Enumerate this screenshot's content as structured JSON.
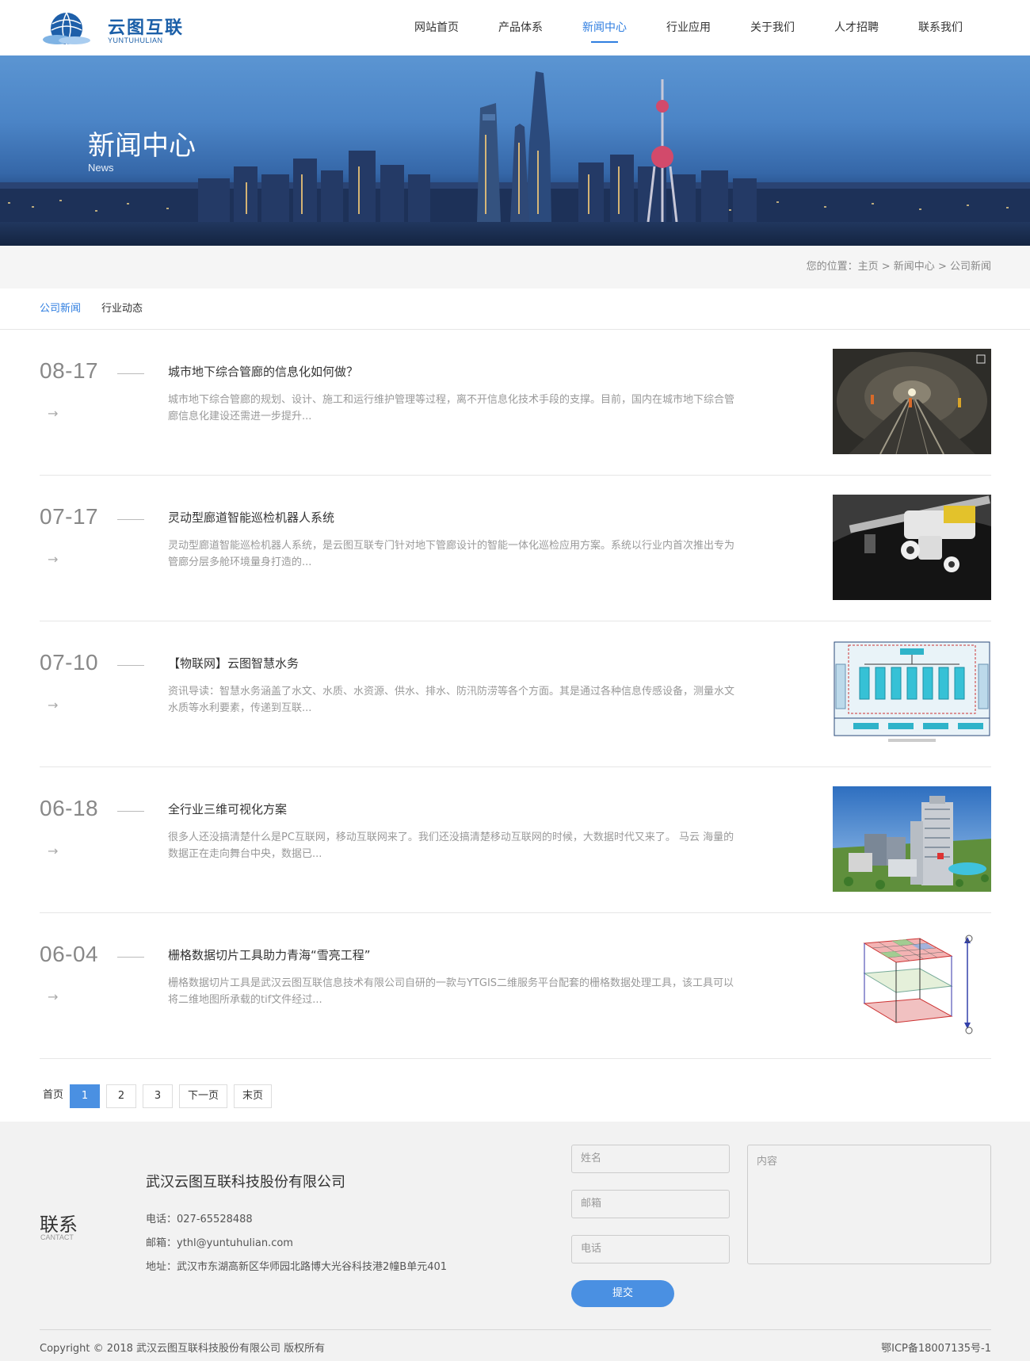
{
  "header": {
    "logo_cn": "云图互联",
    "logo_en": "YUNTUHULIAN",
    "nav": [
      {
        "label": "网站首页"
      },
      {
        "label": "产品体系"
      },
      {
        "label": "新闻中心"
      },
      {
        "label": "行业应用"
      },
      {
        "label": "关于我们"
      },
      {
        "label": "人才招聘"
      },
      {
        "label": "联系我们"
      }
    ],
    "active_nav": "新闻中心"
  },
  "banner": {
    "title": "新闻中心",
    "subtitle": "News"
  },
  "breadcrumb": {
    "prefix": "您的位置：",
    "items": [
      "主页",
      "新闻中心",
      "公司新闻"
    ],
    "separator": " > "
  },
  "subtabs": [
    {
      "label": "公司新闻",
      "active": true
    },
    {
      "label": "行业动态",
      "active": false
    }
  ],
  "news": [
    {
      "date": "08-17",
      "title": "城市地下综合管廊的信息化如何做？",
      "desc": "城市地下综合管廊的规划、设计、施工和运行维护管理等过程，离不开信息化技术手段的支撑。目前，国内在城市地下综合管廊信息化建设还需进一步提升...",
      "thumb_icon": "tunnel-photo"
    },
    {
      "date": "07-17",
      "title": "灵动型廊道智能巡检机器人系统",
      "desc": "灵动型廊道智能巡检机器人系统，是云图互联专门针对地下管廊设计的智能一体化巡检应用方案。系统以行业内首次推出专为管廊分层多舱环境量身打造的...",
      "thumb_icon": "robot-photo"
    },
    {
      "date": "07-10",
      "title": "【物联网】云图智慧水务",
      "desc": "资讯导读：智慧水务涵盖了水文、水质、水资源、供水、排水、防汛防涝等各个方面。其是通过各种信息传感设备，测量水文水质等水利要素，传递到互联...",
      "thumb_icon": "diagram-image"
    },
    {
      "date": "06-18",
      "title": "全行业三维可视化方案",
      "desc": "很多人还没搞清楚什么是PC互联网，移动互联网来了。我们还没搞清楚移动互联网的时候，大数据时代又来了。 马云 海量的数据正在走向舞台中央，数据已...",
      "thumb_icon": "3d-city-image"
    },
    {
      "date": "06-04",
      "title": "栅格数据切片工具助力青海“雪亮工程”",
      "desc": "栅格数据切片工具是武汉云图互联信息技术有限公司自研的一款与YTGIS二维服务平台配套的栅格数据处理工具，该工具可以将二维地图所承载的tif文件经过...",
      "thumb_icon": "raster-tiles-image"
    }
  ],
  "pagination": {
    "first": "首页",
    "pages": [
      "1",
      "2",
      "3"
    ],
    "current": "1",
    "next": "下一页",
    "last": "末页"
  },
  "footer": {
    "contact_cn": "联系",
    "contact_en": "CANTACT",
    "company": "武汉云图互联科技股份有限公司",
    "phone": "电话：027-65528488",
    "email": "邮箱：ythl@yuntuhulian.com",
    "address": "地址：武汉市东湖高新区华师园北路博大光谷科技港2幢B单元401",
    "form": {
      "name_placeholder": "姓名",
      "email_placeholder": "邮箱",
      "phone_placeholder": "电话",
      "content_placeholder": "内容",
      "submit": "提交"
    },
    "copyright": "Copyright © 2018 武汉云图互联科技股份有限公司 版权所有",
    "icp": "鄂ICP备18007135号-1"
  },
  "colors": {
    "accent": "#2f7ee0",
    "brand": "#1b5fa8",
    "button": "#4a90e2"
  }
}
